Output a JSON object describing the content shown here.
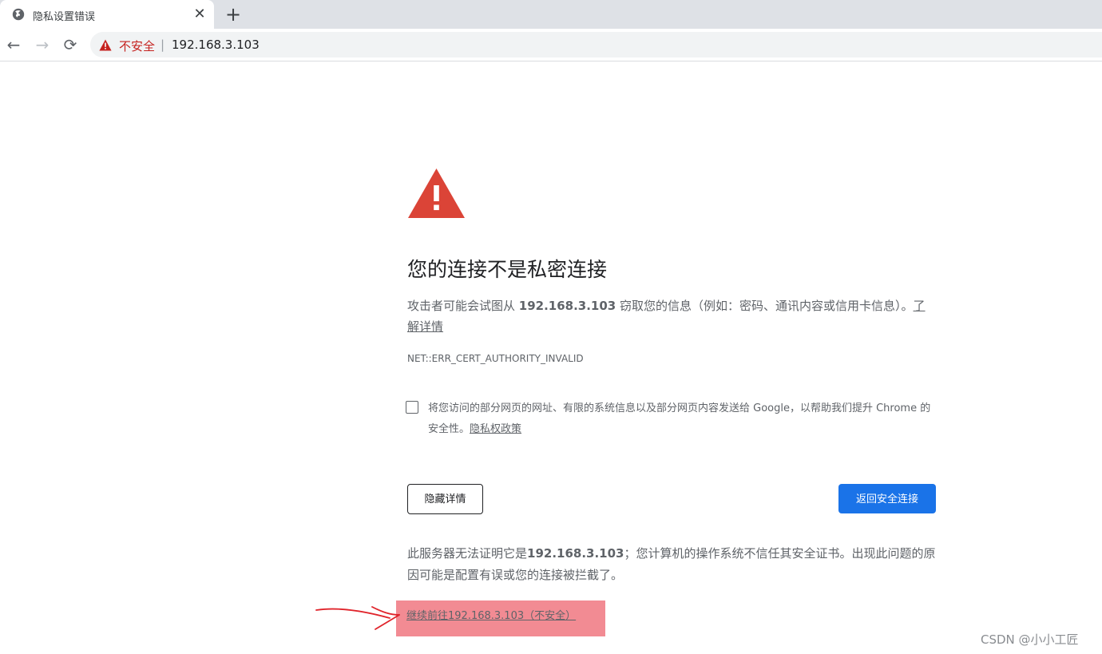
{
  "tab": {
    "title": "隐私设置错误",
    "close_glyph": "✕",
    "favicon": "globe-icon"
  },
  "new_tab_glyph": "+",
  "nav": {
    "back_glyph": "←",
    "forward_glyph": "→",
    "reload_glyph": "⟳"
  },
  "omnibox": {
    "security_label": "不安全",
    "separator": "|",
    "url": "192.168.3.103",
    "security_color": "#c5221f"
  },
  "interstitial": {
    "heading": "您的连接不是私密连接",
    "explanation_pre": "攻击者可能会试图从 ",
    "explanation_host": "192.168.3.103",
    "explanation_post": " 窃取您的信息（例如：密码、通讯内容或信用卡信息）。",
    "learn_more": "了解详情",
    "error_code": "NET::ERR_CERT_AUTHORITY_INVALID",
    "report_text": "将您访问的部分网页的网址、有限的系统信息以及部分网页内容发送给 Google，以帮助我们提升 Chrome 的安全性。",
    "privacy_policy": "隐私权政策",
    "hide_details": "隐藏详情",
    "back_to_safety": "返回安全连接",
    "detail_pre": "此服务器无法证明它是",
    "detail_host": "192.168.3.103",
    "detail_post": "；您计算机的操作系统不信任其安全证书。出现此问题的原因可能是配置有误或您的连接被拦截了。",
    "proceed_link": "继续前往192.168.3.103（不安全）",
    "warning_color": "#db4437",
    "primary_button_color": "#1a73e8",
    "annotation_highlight_color": "#f28b93",
    "annotation_arrow_color": "#e0242b"
  },
  "watermark": "CSDN @小小工匠"
}
